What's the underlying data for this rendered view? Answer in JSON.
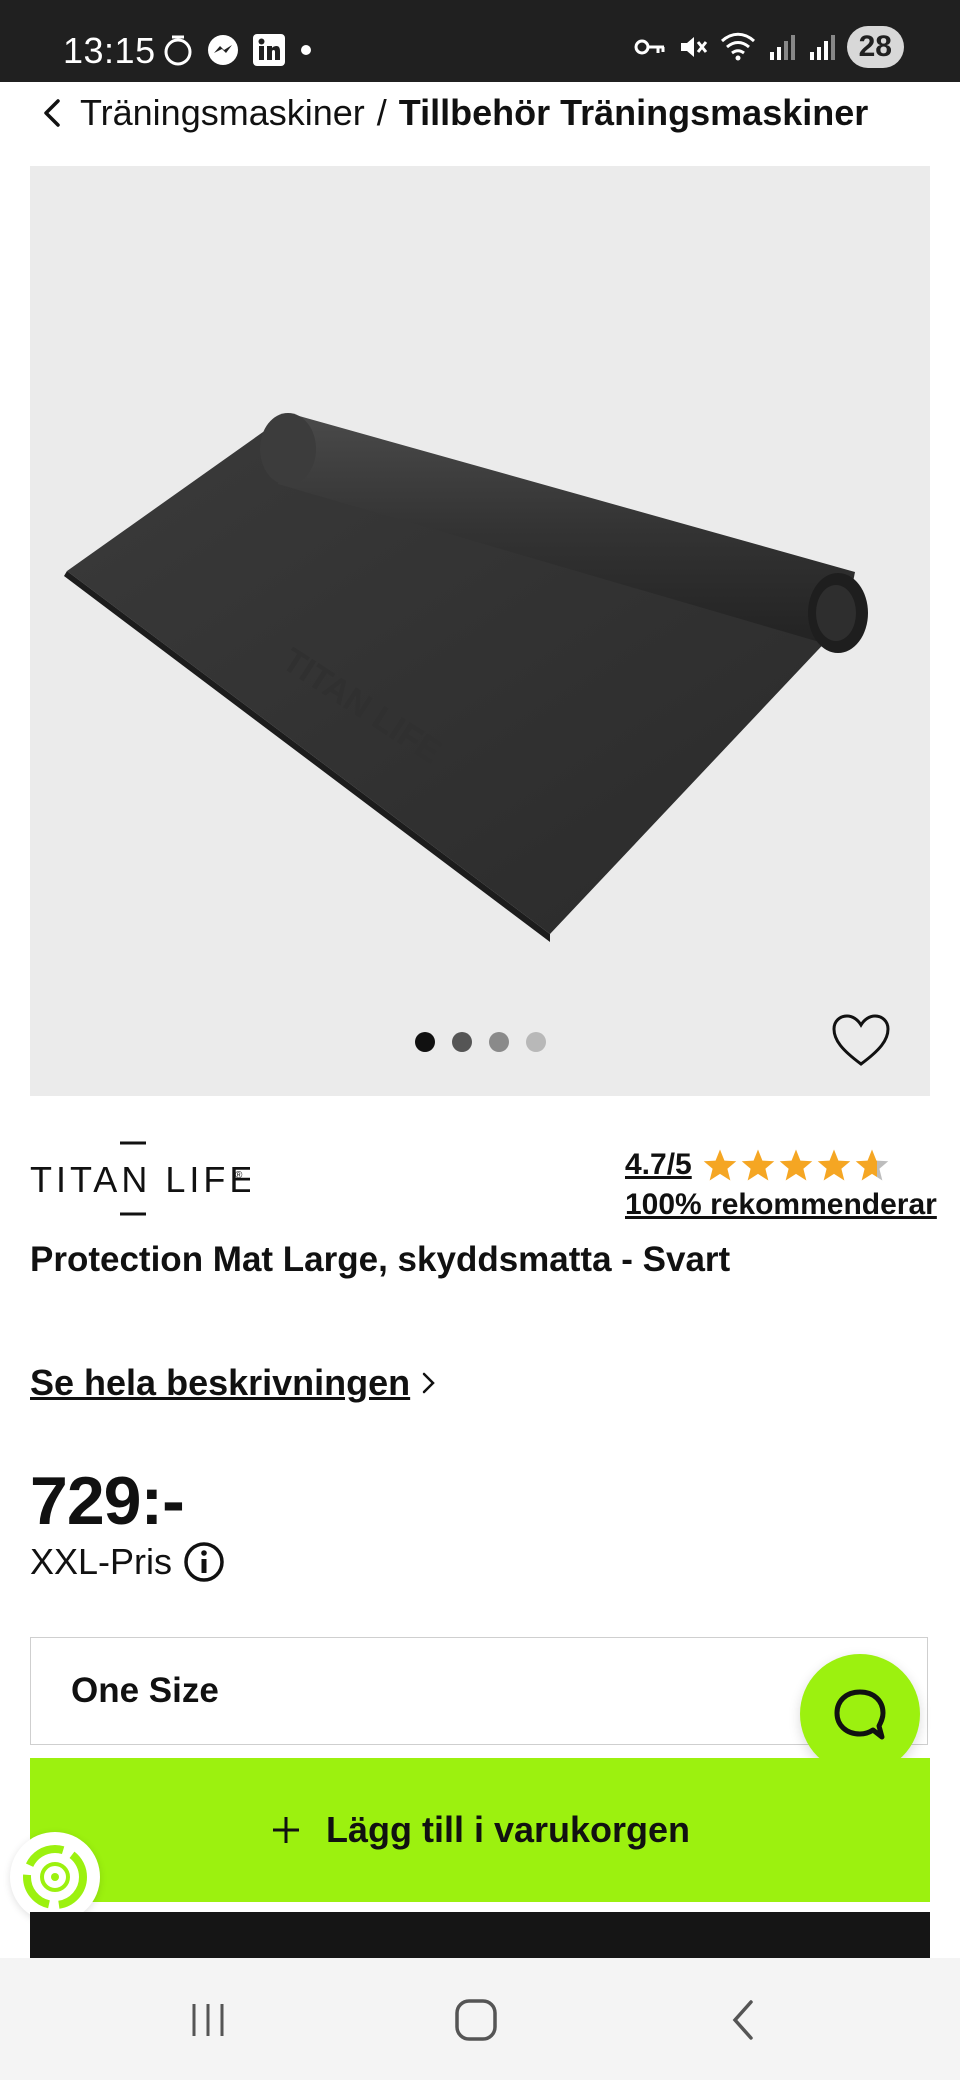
{
  "status_bar": {
    "time": "13:15",
    "battery": "28",
    "left_icons": [
      "timer-icon",
      "messenger-icon",
      "linkedin-icon",
      "dot-icon"
    ],
    "right_icons": [
      "key-icon",
      "mute-icon",
      "wifi-icon",
      "signal-icon",
      "signal-icon"
    ]
  },
  "breadcrumb": {
    "parent": "Träningsmaskiner",
    "separator": "/",
    "current": "Tillbehör Träningsmaskiner"
  },
  "gallery": {
    "image": "black-protection-mat-photo",
    "dot_count": 4,
    "active_dot": 0
  },
  "brand": {
    "name": "TITAN LIFE"
  },
  "rating": {
    "score": "4.7/5",
    "stars": 4.7,
    "recommend": "100% rekommenderar",
    "star_color": "#f5a623"
  },
  "product": {
    "title": "Protection Mat Large, skyddsmatta - Svart",
    "description_link": "Se hela beskrivningen",
    "price": "729:-",
    "price_label": "XXL-Pris"
  },
  "size_selector": {
    "value": "One Size"
  },
  "cart": {
    "label": "Lägg till i varukorgen",
    "accent": "#9cf10f"
  },
  "nav_bar": {
    "items": [
      "recent-apps-icon",
      "home-icon",
      "back-icon"
    ]
  }
}
